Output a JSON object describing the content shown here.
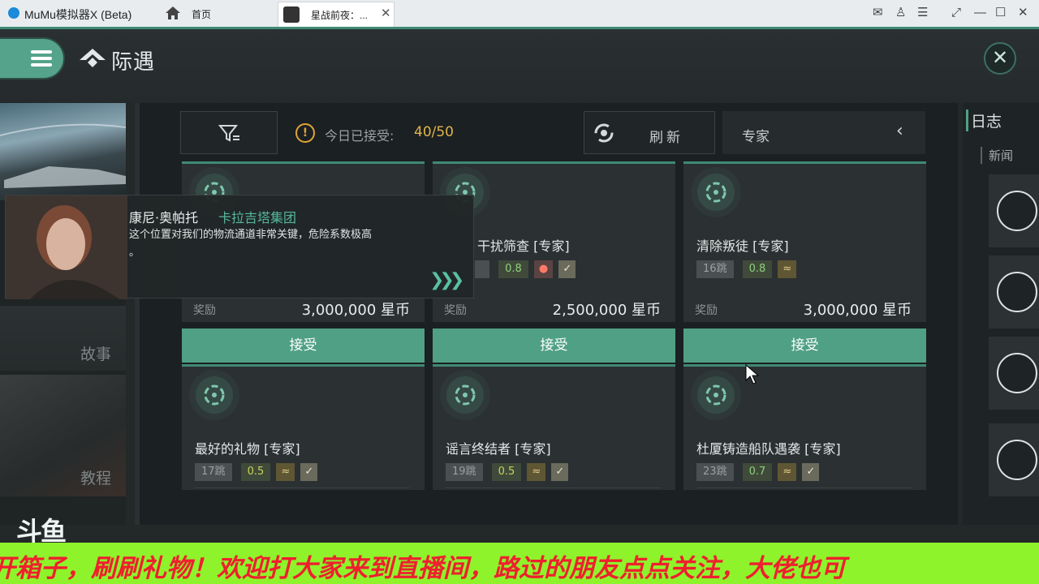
{
  "titlebar": {
    "app_name": "MuMu模拟器X (Beta)",
    "home_label": "首页",
    "active_tab_label": "星战前夜：...",
    "icons": [
      "mail-icon",
      "account-icon",
      "menu-icon",
      "screen-icon",
      "minimize-icon",
      "maximize-icon",
      "close-icon"
    ]
  },
  "header": {
    "title": "际遇",
    "close_symbol": "✕"
  },
  "left_nav": {
    "story_label": "故事",
    "tutorial_label": "教程"
  },
  "toolbar": {
    "accepted_label": "今日已接受:",
    "accepted_count": "40/50",
    "refresh_label": "刷新",
    "level_label": "专家",
    "collapse_symbol": "‹",
    "warn_symbol": "!"
  },
  "cards_row1": [
    {
      "title": "",
      "jumps": "",
      "security": "",
      "reward_label": "奖励",
      "reward": "3,000,000 星币",
      "accept": "接受"
    },
    {
      "title": "干扰筛查 [专家]",
      "jumps": "",
      "security": "0.8",
      "reward_label": "奖励",
      "reward": "2,500,000 星币",
      "accept": "接受"
    },
    {
      "title": "清除叛徒 [专家]",
      "jumps": "16跳",
      "security": "0.8",
      "reward_label": "奖励",
      "reward": "3,000,000 星币",
      "accept": "接受"
    }
  ],
  "cards_row2": [
    {
      "title": "最好的礼物 [专家]",
      "jumps": "17跳",
      "security": "0.5"
    },
    {
      "title": "谣言终结者 [专家]",
      "jumps": "19跳",
      "security": "0.5"
    },
    {
      "title": "杜厦铸造船队遇袭 [专家]",
      "jumps": "23跳",
      "security": "0.7"
    }
  ],
  "dialog": {
    "name": "康尼·奥帕托",
    "corp": "卡拉吉塔集团",
    "text": "这个位置对我们的物流通道非常关键，危险系数极高",
    "text2": "。",
    "arrows": "❯❯❯"
  },
  "right_panel": {
    "title": "日志",
    "news_label": "新闻"
  },
  "stream": {
    "logo": "斗鱼",
    "ticker": "开箱子，刷刷礼物！欢迎打大家来到直播间，路过的朋友点点关注，大佬也可"
  },
  "colors": {
    "accent": "#4fa084",
    "warning": "#e0a43a",
    "ticker_bg": "#8ef32a",
    "ticker_text": "#ef1f2f"
  }
}
